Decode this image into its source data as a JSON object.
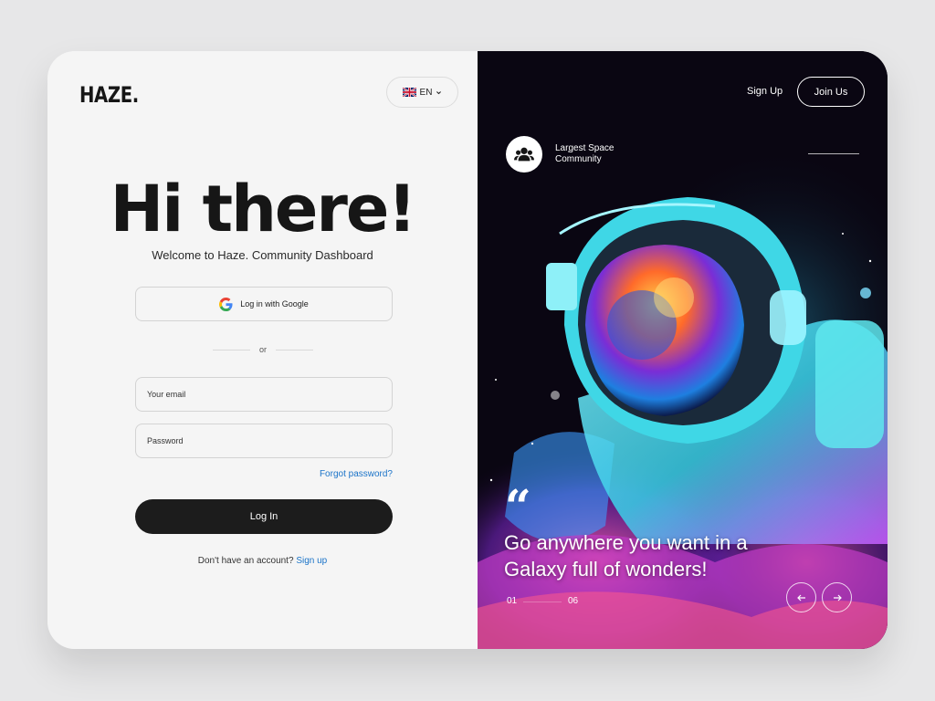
{
  "brand": {
    "logo": "HAZE."
  },
  "language": {
    "code": "EN",
    "flag": "uk-flag-icon"
  },
  "login": {
    "headline": "Hi there!",
    "subtitle": "Welcome to Haze. Community Dashboard",
    "google_label": "Log in with Google",
    "divider_text": "or",
    "email_placeholder": "Your email",
    "password_placeholder": "Password",
    "forgot_label": "Forgot password?",
    "submit_label": "Log In",
    "no_account_text": "Don't have an account?",
    "signup_link": "Sign up"
  },
  "hero": {
    "nav_signup": "Sign Up",
    "nav_join": "Join Us",
    "community_label": "Largest Space Community",
    "quote_mark": "“",
    "quote": "Go anywhere you want in a Galaxy full of wonders!",
    "page_current": "01",
    "page_total": "06",
    "image": "astronaut-illustration"
  },
  "colors": {
    "accent_link": "#1a73c8",
    "button_dark": "#1c1c1c",
    "panel_light": "#f5f5f5",
    "panel_dark": "#0a0612"
  }
}
